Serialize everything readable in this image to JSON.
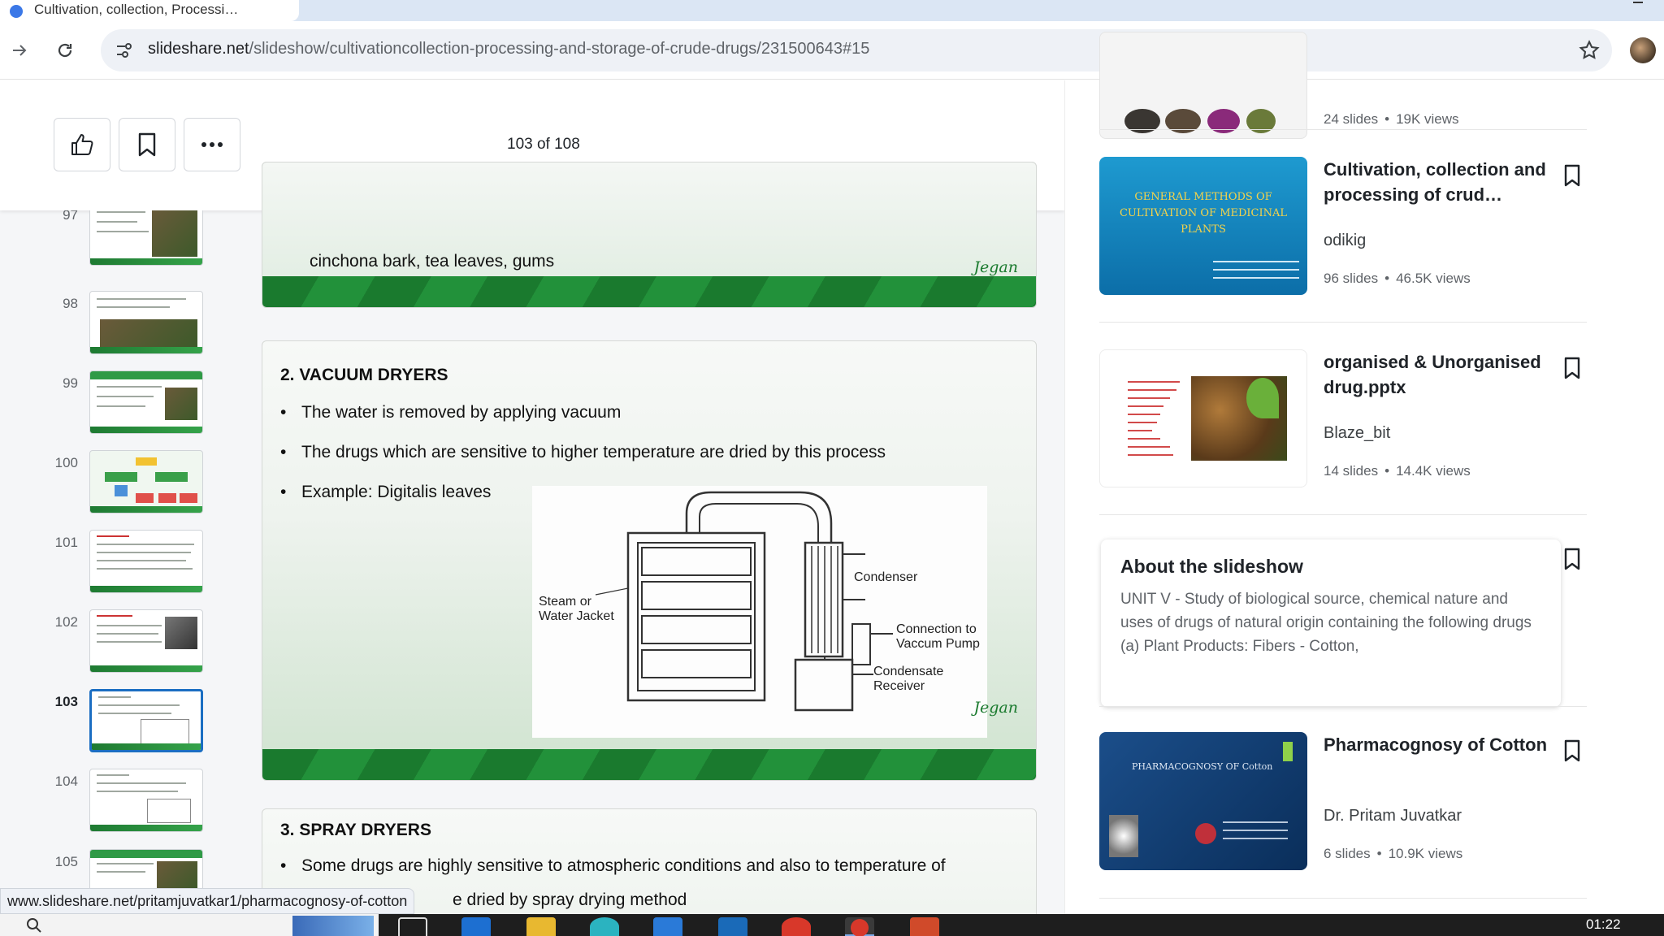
{
  "browser": {
    "tab_title": "Cultivation, collection, Processi…",
    "url_domain": "slideshare.net",
    "url_path": "/slideshow/cultivationcollection-processing-and-storage-of-crude-drugs/231500643#15",
    "status_link": "www.slideshare.net/pritamjuvatkar1/pharmacognosy-of-cotton"
  },
  "viewer": {
    "page_indicator": "103 of 108",
    "thumbnails": [
      {
        "num": "97",
        "active": false
      },
      {
        "num": "98",
        "active": false
      },
      {
        "num": "99",
        "active": false
      },
      {
        "num": "100",
        "active": false
      },
      {
        "num": "101",
        "active": false
      },
      {
        "num": "102",
        "active": false
      },
      {
        "num": "103",
        "active": true
      },
      {
        "num": "104",
        "active": false
      },
      {
        "num": "105",
        "active": false
      }
    ]
  },
  "slides": {
    "s102": {
      "text": "cinchona bark, tea leaves, gums",
      "signature": "Jegan"
    },
    "s103": {
      "title": "2. VACUUM DRYERS",
      "bullets": [
        "The water is removed by applying vacuum",
        "The drugs which are sensitive to higher temperature are dried by this process",
        "Example: Digitalis leaves"
      ],
      "diagram_labels": {
        "steam_line1": "Steam or",
        "steam_line2": "Water Jacket",
        "condenser": "Condenser",
        "connection_line1": "Connection to",
        "connection_line2": "Vaccum Pump",
        "receiver_line1": "Condensate",
        "receiver_line2": "Receiver"
      },
      "signature": "Jegan"
    },
    "s104": {
      "title": "3. SPRAY DRYERS",
      "bullet1": "Some drugs are highly sensitive to atmospheric conditions and also to temperature of",
      "line2": "e dried by spray drying method"
    }
  },
  "sidebar": {
    "top_card_meta": {
      "slides": "24 slides",
      "views": "19K views"
    },
    "cards": [
      {
        "title": "Cultivation, collection and processing of crud…",
        "author": "odikig",
        "slides": "96 slides",
        "views": "46.5K views",
        "thumb_text": "GENERAL METHODS OF CULTIVATION OF MEDICINAL PLANTS"
      },
      {
        "title": "organised & Unorganised drug.pptx",
        "author": "Blaze_bit",
        "slides": "14 slides",
        "views": "14.4K views"
      },
      {
        "title": "Pharmacognosy of Cotton",
        "author": "Dr. Pritam Juvatkar",
        "slides": "6 slides",
        "views": "10.9K views",
        "thumb_text": "PHARMACOGNOSY OF Cotton"
      }
    ],
    "about": {
      "title": "About the slideshow",
      "text": "UNIT V - Study of biological source, chemical nature and uses of drugs of natural origin containing the following drugs (a) Plant Products: Fibers - Cotton,"
    }
  },
  "taskbar": {
    "clock": "01:22"
  }
}
